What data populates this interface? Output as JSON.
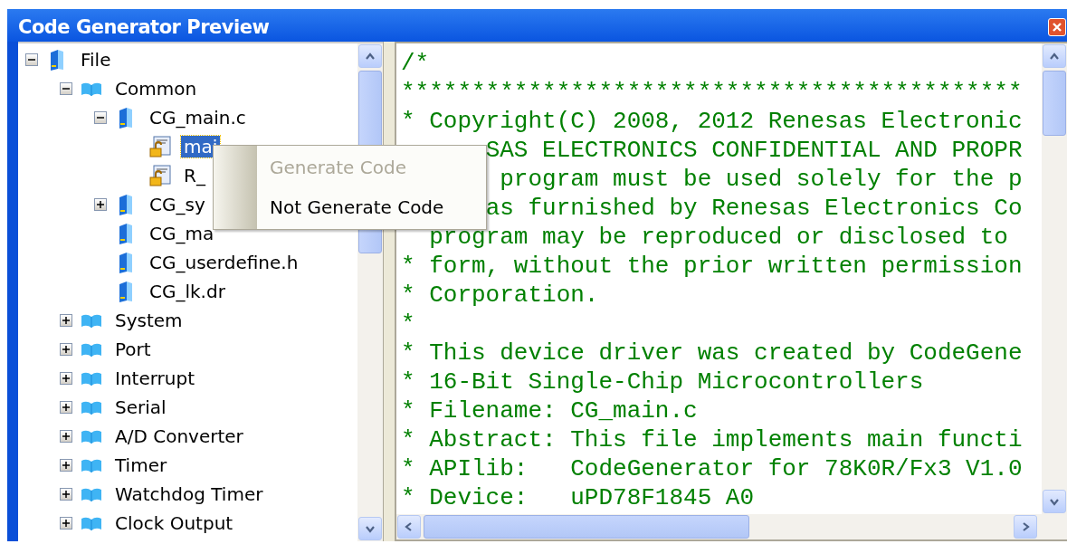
{
  "window": {
    "title": "Code Generator Preview"
  },
  "tree": [
    {
      "label": "File",
      "kind": "file",
      "expanded": true,
      "selected": false,
      "children": [
        {
          "label": "Common",
          "kind": "folder",
          "expanded": true,
          "selected": false,
          "children": [
            {
              "label": "CG_main.c",
              "kind": "file",
              "expanded": true,
              "selected": false,
              "children": [
                {
                  "label": "mai",
                  "kind": "function",
                  "selected": true
                },
                {
                  "label": "R_",
                  "kind": "function",
                  "selected": false
                }
              ]
            },
            {
              "label": "CG_sy",
              "kind": "file",
              "expanded": false,
              "selected": false
            },
            {
              "label": "CG_ma",
              "kind": "file",
              "selected": false
            },
            {
              "label": "CG_userdefine.h",
              "kind": "file",
              "selected": false
            },
            {
              "label": "CG_lk.dr",
              "kind": "file",
              "selected": false
            }
          ]
        },
        {
          "label": "System",
          "kind": "folder",
          "expanded": false,
          "selected": false
        },
        {
          "label": "Port",
          "kind": "folder",
          "expanded": false,
          "selected": false
        },
        {
          "label": "Interrupt",
          "kind": "folder",
          "expanded": false,
          "selected": false
        },
        {
          "label": "Serial",
          "kind": "folder",
          "expanded": false,
          "selected": false
        },
        {
          "label": "A/D Converter",
          "kind": "folder",
          "expanded": false,
          "selected": false
        },
        {
          "label": "Timer",
          "kind": "folder",
          "expanded": false,
          "selected": false
        },
        {
          "label": "Watchdog Timer",
          "kind": "folder",
          "expanded": false,
          "selected": false
        },
        {
          "label": "Clock Output",
          "kind": "folder",
          "expanded": false,
          "selected": false
        }
      ]
    }
  ],
  "code_lines": [
    "/*",
    "********************************************",
    "* Copyright(C) 2008, 2012 Renesas Electronic",
    "      SAS ELECTRONICS CONFIDENTIAL AND PROPR",
    "       program must be used solely for the p",
    "      as furnished by Renesas Electronics Co",
    "  program may be reproduced or disclosed to",
    "* form, without the prior written permission",
    "* Corporation.",
    "*",
    "* This device driver was created by CodeGene",
    "* 16-Bit Single-Chip Microcontrollers",
    "* Filename: CG_main.c",
    "* Abstract: This file implements main functi",
    "* APIlib:   CodeGenerator for 78K0R/Fx3 V1.0",
    "* Device:   uPD78F1845 A0"
  ],
  "context_menu": [
    {
      "label": "Generate Code",
      "disabled": true
    },
    {
      "label": "Not Generate Code",
      "disabled": false
    }
  ]
}
